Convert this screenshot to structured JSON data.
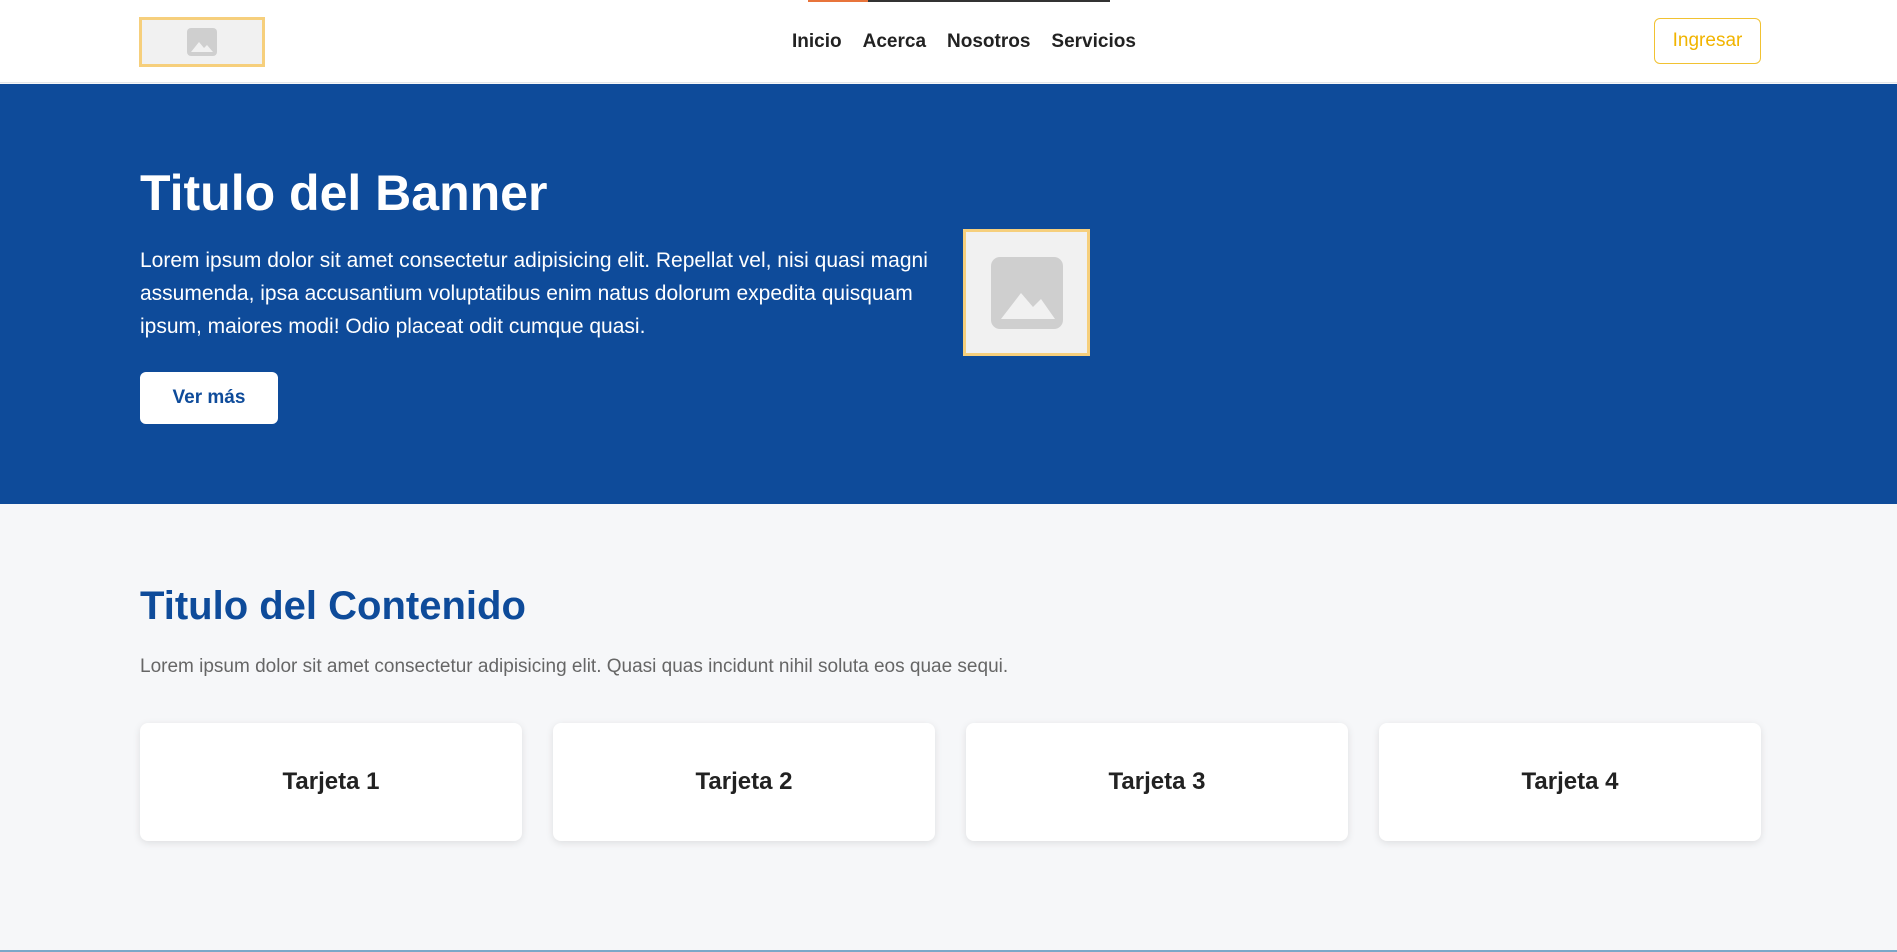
{
  "header": {
    "logo_icon": "image-placeholder-icon",
    "nav": [
      "Inicio",
      "Acerca",
      "Nosotros",
      "Servicios"
    ],
    "login_label": "Ingresar"
  },
  "hero": {
    "title": "Titulo del Banner",
    "text": "Lorem ipsum dolor sit amet consectetur adipisicing elit. Repellat vel, nisi quasi magni assumenda, ipsa accusantium voluptatibus enim natus dolorum expedita quisquam ipsum, maiores modi! Odio placeat odit cumque quasi.",
    "button_label": "Ver más",
    "image_icon": "image-placeholder-icon"
  },
  "content": {
    "title": "Titulo del Contenido",
    "text": "Lorem ipsum dolor sit amet consectetur adipisicing elit. Quasi quas incidunt nihil soluta eos quae sequi.",
    "cards": [
      "Tarjeta 1",
      "Tarjeta 2",
      "Tarjeta 3",
      "Tarjeta 4"
    ]
  },
  "colors": {
    "primary": "#0e4b9a",
    "accent": "#f1b400",
    "placeholder_border": "#f6cf7c"
  }
}
